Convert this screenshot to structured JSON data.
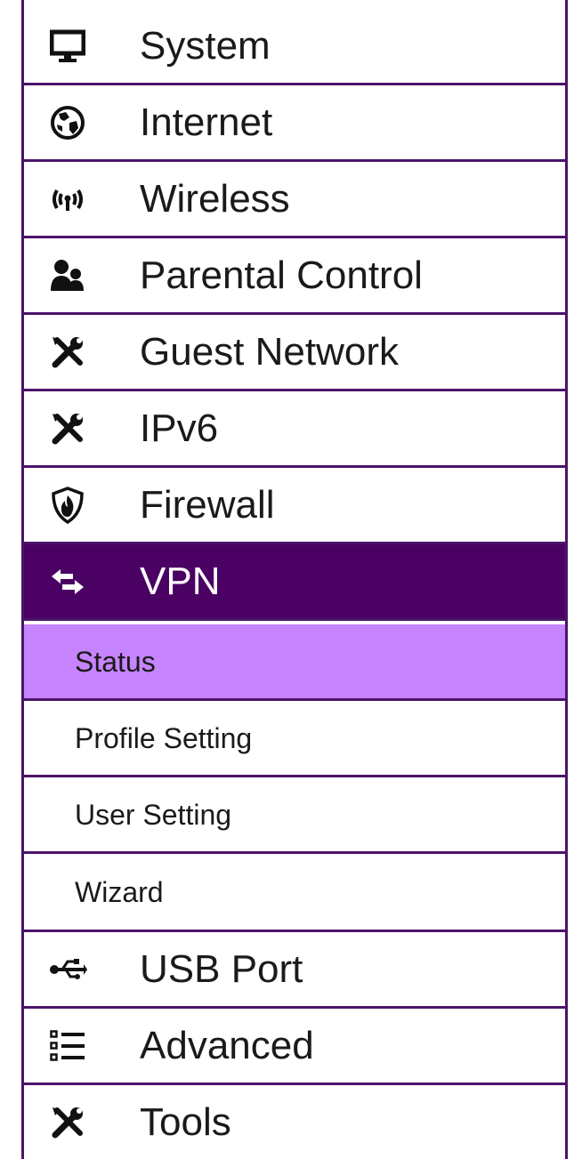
{
  "colors": {
    "border": "#4b1469",
    "active_bg": "#4b0063",
    "selected_sub_bg": "#c784ff"
  },
  "menu": {
    "items": [
      {
        "label": "System",
        "icon": "monitor-icon"
      },
      {
        "label": "Internet",
        "icon": "globe-icon"
      },
      {
        "label": "Wireless",
        "icon": "wireless-icon"
      },
      {
        "label": "Parental Control",
        "icon": "users-icon"
      },
      {
        "label": "Guest Network",
        "icon": "tools-icon"
      },
      {
        "label": "IPv6",
        "icon": "tools-icon"
      },
      {
        "label": "Firewall",
        "icon": "firewall-shield-icon"
      },
      {
        "label": "VPN",
        "icon": "exchange-arrows-icon",
        "active": true
      },
      {
        "label": "USB Port",
        "icon": "usb-icon"
      },
      {
        "label": "Advanced",
        "icon": "list-icon"
      },
      {
        "label": "Tools",
        "icon": "tools-icon"
      }
    ],
    "vpn_submenu": [
      {
        "label": "Status",
        "selected": true
      },
      {
        "label": "Profile Setting"
      },
      {
        "label": "User Setting"
      },
      {
        "label": "Wizard"
      }
    ]
  }
}
